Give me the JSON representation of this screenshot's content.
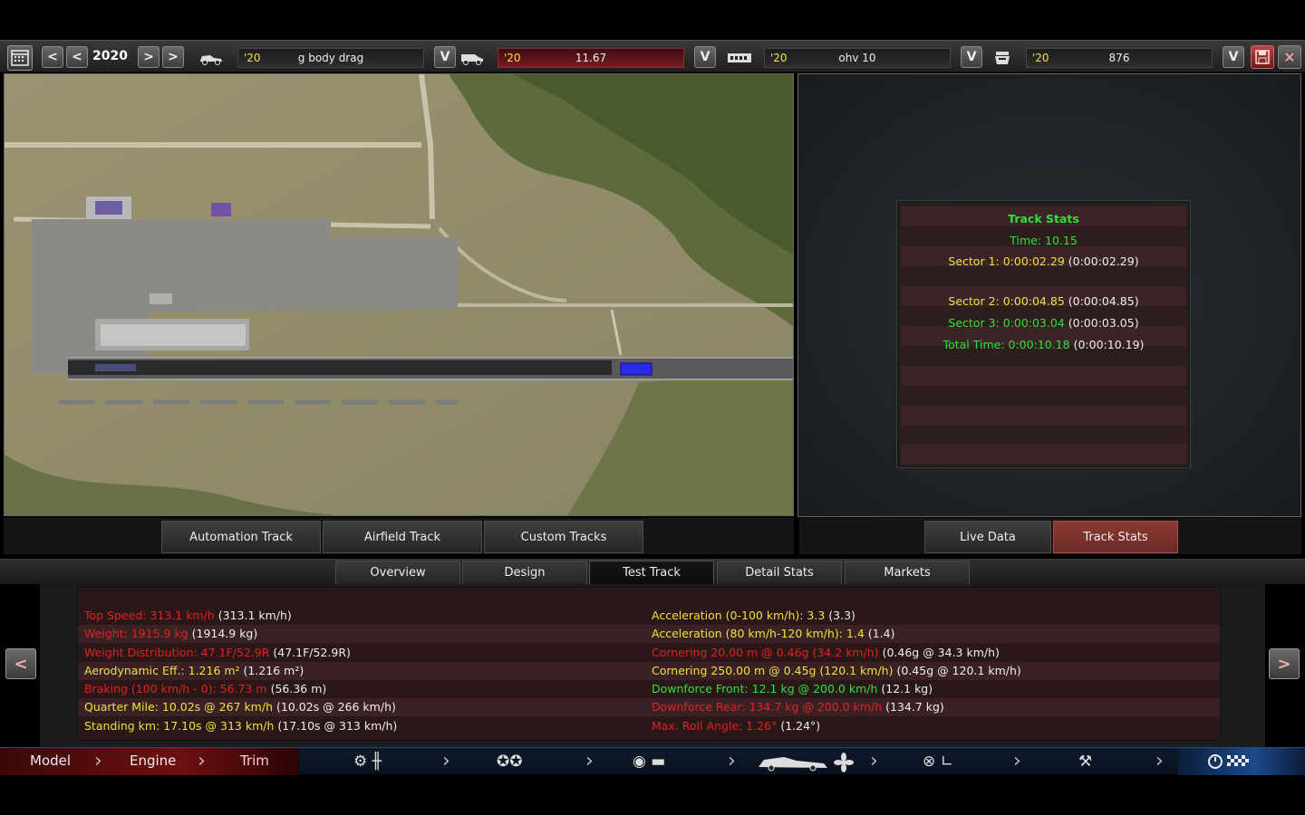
{
  "toolbar": {
    "year": "2020",
    "fields": [
      {
        "year": "'20",
        "value": "g body drag"
      },
      {
        "year": "'20",
        "value": "11.67"
      },
      {
        "year": "'20",
        "value": "ohv 10"
      },
      {
        "year": "'20",
        "value": "876"
      }
    ],
    "arrow_left": "<",
    "arrow_right": ">",
    "dropdown": "V",
    "close": "✕"
  },
  "map_tabs": [
    "Automation Track",
    "Airfield Track",
    "Custom Tracks"
  ],
  "right_tabs": {
    "live": "Live Data",
    "stats": "Track Stats"
  },
  "track_stats": {
    "title": "Track Stats",
    "time": "Time: 10.15",
    "sector1_label": "Sector 1: 0:00:02.29",
    "sector1_prev": "(0:00:02.29)",
    "sector2_label": "Sector 2: 0:00:04.85",
    "sector2_prev": "(0:00:04.85)",
    "sector3_label": "Sector 3: 0:00:03.04",
    "sector3_prev": "(0:00:03.05)",
    "total_label": "Total Time: 0:00:10.18",
    "total_prev": "(0:00:10.19)"
  },
  "bottom_tabs": [
    "Overview",
    "Design",
    "Test Track",
    "Detail Stats",
    "Markets"
  ],
  "stats_left": [
    {
      "label": "Top Speed: 313.1 km/h",
      "prev": "(313.1 km/h)",
      "color": "#e02222"
    },
    {
      "label": "Weight: 1915.9 kg",
      "prev": "(1914.9 kg)",
      "color": "#e02222"
    },
    {
      "label": "Weight Distribution: 47.1F/52.9R",
      "prev": "(47.1F/52.9R)",
      "color": "#e02222"
    },
    {
      "label": "Aerodynamic Eff.: 1.216 m²",
      "prev": "(1.216 m²)",
      "color": "#f0e040"
    },
    {
      "label": "Braking (100 km/h - 0): 56.73 m",
      "prev": "(56.36 m)",
      "color": "#e02222"
    },
    {
      "label": "Quarter Mile: 10.02s @ 267 km/h",
      "prev": "(10.02s @ 266 km/h)",
      "color": "#f0e040"
    },
    {
      "label": "Standing km: 17.10s @ 313 km/h",
      "prev": "(17.10s @ 313 km/h)",
      "color": "#f0e040"
    }
  ],
  "stats_right": [
    {
      "label": "Acceleration (0-100 km/h): 3.3",
      "prev": "(3.3)",
      "color": "#f0e040"
    },
    {
      "label": "Acceleration (80 km/h-120 km/h): 1.4",
      "prev": "(1.4)",
      "color": "#f0e040"
    },
    {
      "label": "Cornering 20.00 m @ 0.46g (34.2 km/h)",
      "prev": "(0.46g @ 34.3 km/h)",
      "color": "#e02222"
    },
    {
      "label": "Cornering 250.00 m @ 0.45g (120.1 km/h)",
      "prev": "(0.45g @ 120.1 km/h)",
      "color": "#f0e040"
    },
    {
      "label": "Downforce Front: 12.1 kg @ 200.0 km/h",
      "prev": "(12.1 kg)",
      "color": "#2ee23a"
    },
    {
      "label": "Downforce Rear: 134.7 kg @ 200.0 km/h",
      "prev": "(134.7 kg)",
      "color": "#e02222"
    },
    {
      "label": "Max. Roll Angle: 1.26°",
      "prev": "(1.24°)",
      "color": "#e02222"
    }
  ],
  "nav": {
    "model": "Model",
    "engine": "Engine",
    "trim": "Trim"
  },
  "icons": [
    "calendar-icon",
    "car-body-icon",
    "van-icon",
    "engine-block-icon",
    "engine-icon",
    "save-icon",
    "close-icon"
  ]
}
